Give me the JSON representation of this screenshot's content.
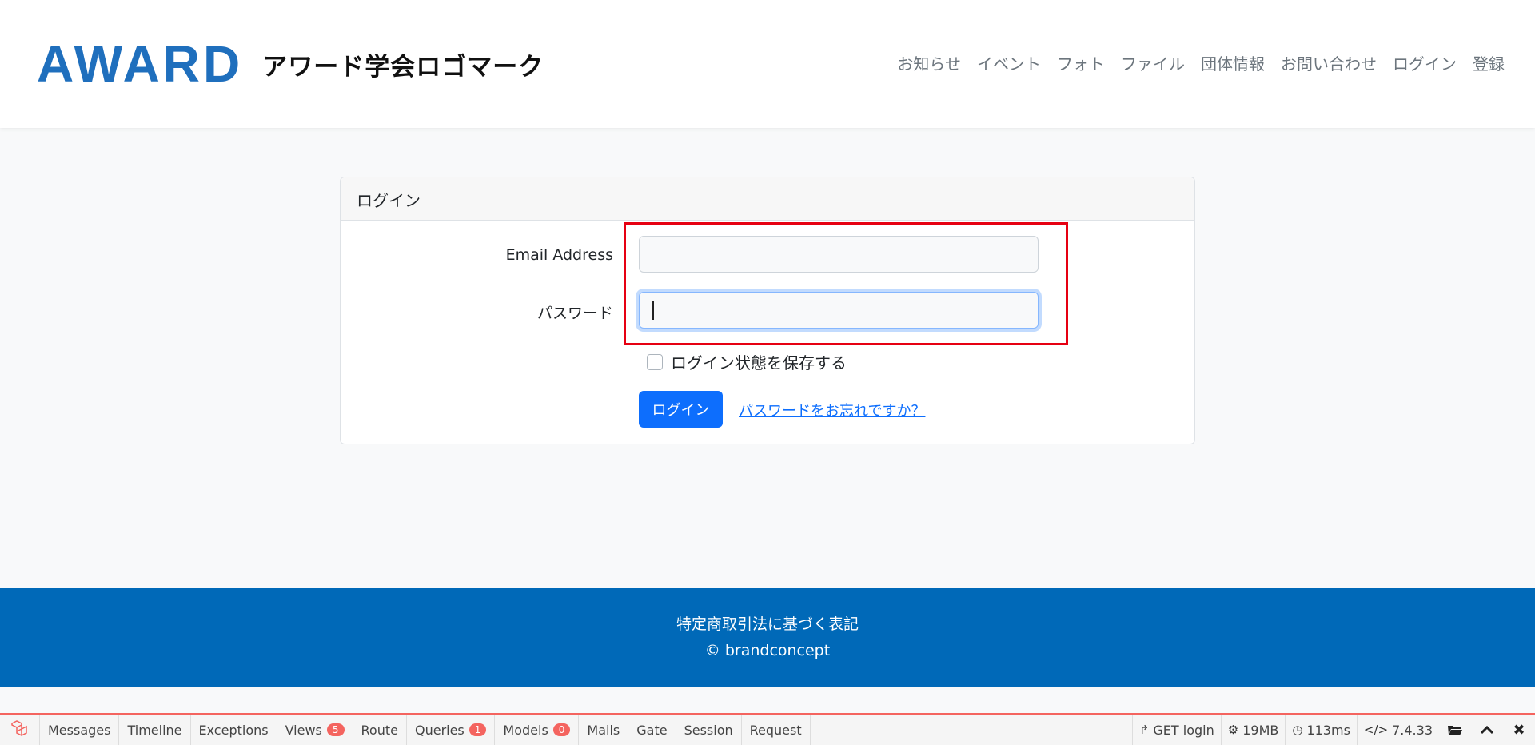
{
  "header": {
    "logo_text": "AWARD",
    "brand_name": "アワード学会ロゴマーク",
    "nav": [
      {
        "label": "お知らせ"
      },
      {
        "label": "イベント"
      },
      {
        "label": "フォト"
      },
      {
        "label": "ファイル"
      },
      {
        "label": "団体情報"
      },
      {
        "label": "お問い合わせ"
      },
      {
        "label": "ログイン"
      },
      {
        "label": "登録"
      }
    ]
  },
  "login_card": {
    "title": "ログイン",
    "email_label": "Email Address",
    "email_value": "",
    "password_label": "パスワード",
    "password_value": "",
    "remember_label": "ログイン状態を保存する",
    "remember_checked": false,
    "submit_label": "ログイン",
    "forgot_link": "パスワードをお忘れですか？"
  },
  "footer": {
    "legal_link": "特定商取引法に基づく表記",
    "copyright": "© brandconcept"
  },
  "debugbar": {
    "tabs": [
      {
        "label": "Messages"
      },
      {
        "label": "Timeline"
      },
      {
        "label": "Exceptions"
      },
      {
        "label": "Views",
        "badge": "5"
      },
      {
        "label": "Route"
      },
      {
        "label": "Queries",
        "badge": "1"
      },
      {
        "label": "Models",
        "badge": "0"
      },
      {
        "label": "Mails"
      },
      {
        "label": "Gate"
      },
      {
        "label": "Session"
      },
      {
        "label": "Request"
      }
    ],
    "request": "GET login",
    "memory": "19MB",
    "time": "113ms",
    "php_version": "7.4.33"
  },
  "colors": {
    "brand_blue": "#1f6fbd",
    "footer_blue": "#0069b8",
    "primary": "#0d6efd",
    "highlight_red": "#e60012",
    "debugbar_accent": "#f4645f"
  }
}
